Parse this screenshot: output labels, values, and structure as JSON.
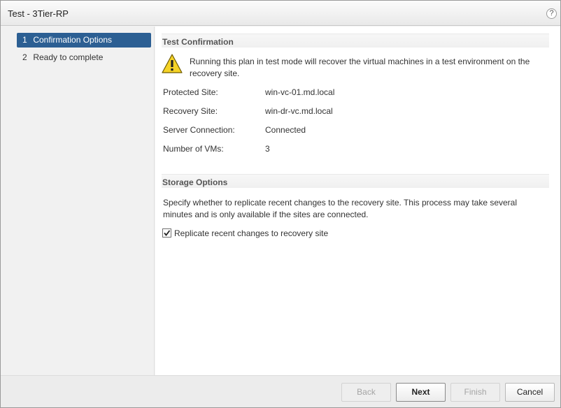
{
  "dialog": {
    "title": "Test - 3Tier-RP",
    "help_label": "?"
  },
  "sidebar": {
    "steps": [
      {
        "num": "1",
        "label": "Confirmation Options"
      },
      {
        "num": "2",
        "label": "Ready to complete"
      }
    ]
  },
  "confirmation": {
    "header": "Test Confirmation",
    "warning": "Running this plan in test mode will recover the virtual machines in a test environment on the recovery site.",
    "properties": [
      {
        "label": "Protected Site:",
        "value": "win-vc-01.md.local"
      },
      {
        "label": "Recovery Site:",
        "value": "win-dr-vc.md.local"
      },
      {
        "label": "Server Connection:",
        "value": "Connected"
      },
      {
        "label": "Number of VMs:",
        "value": "3"
      }
    ]
  },
  "storage": {
    "header": "Storage Options",
    "description": "Specify whether to replicate recent changes to the recovery site. This process may take several minutes and is only available if the sites are connected.",
    "replicate_label": "Replicate recent changes to recovery site",
    "replicate_checked": true
  },
  "footer": {
    "back_label": "Back",
    "next_label": "Next",
    "finish_label": "Finish",
    "cancel_label": "Cancel"
  },
  "colors": {
    "active_step": "#2c5f93",
    "warning_fill": "#f5d327"
  }
}
